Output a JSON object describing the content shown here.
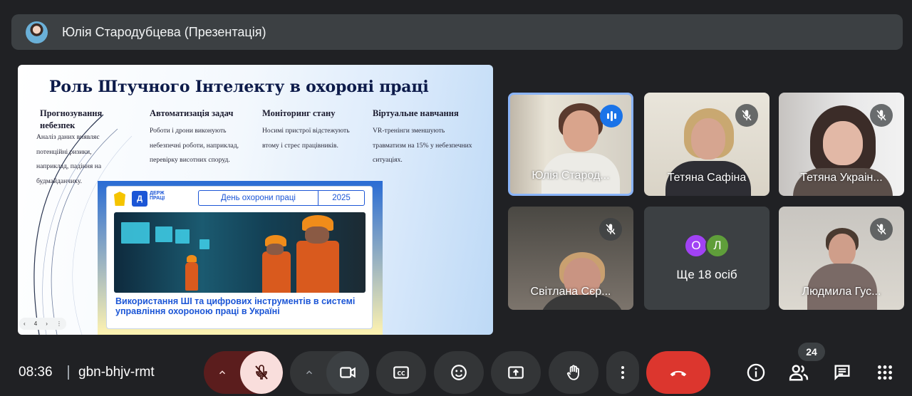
{
  "presenter_bar": {
    "title": "Юлія Стародубцева (Презентація)"
  },
  "slide": {
    "title": "Роль Штучного Інтелекту в охороні праці",
    "columns": [
      {
        "heading": "Прогнозування небезпек",
        "text": "Аналіз даних виявляє потенційні ризики, наприклад, падіння на будмайданчику."
      },
      {
        "heading": "Автоматизація задач",
        "text": "Роботи і дрони виконують небезпечні роботи, наприклад, перевірку висотних споруд."
      },
      {
        "heading": "Моніторинг стану",
        "text": "Носимі пристрої відстежують втому і стрес працівників."
      },
      {
        "heading": "Віртуальне навчання",
        "text": "VR-тренінги зменшують травматизм на 15% у небезпечних ситуаціях."
      }
    ],
    "poster": {
      "logo_text": "ДЕРЖ ПРАЦІ",
      "day_label": "День охорони праці",
      "year": "2025",
      "caption": "Використання ШІ та цифрових інструментів в системі управління охороною праці в Україні"
    },
    "nav": {
      "prev": "‹",
      "page": "4",
      "next": "›",
      "more": "⋮"
    }
  },
  "participants": [
    {
      "name": "Юлія Старод...",
      "state": "speaking"
    },
    {
      "name": "Тетяна Сафіна",
      "state": "muted"
    },
    {
      "name": "Тетяна Украін...",
      "state": "muted"
    },
    {
      "name": "Світлана Сєр...",
      "state": "muted"
    },
    {
      "name": "Ще 18 осіб",
      "state": "more",
      "avatars": [
        {
          "letter": "О",
          "color": "#a142f4"
        },
        {
          "letter": "Л",
          "color": "#5f9e3a"
        }
      ]
    },
    {
      "name": "Людмила Гус...",
      "state": "muted"
    }
  ],
  "bottom_bar": {
    "time": "08:36",
    "meeting_code": "gbn-bhjv-rmt",
    "participant_count": "24"
  },
  "colors": {
    "background": "#202124",
    "end_call": "#dc362e",
    "mic_muted_bg": "#f9dedc",
    "speaking": "#1a73e8",
    "active_border": "#8ab4f8"
  }
}
